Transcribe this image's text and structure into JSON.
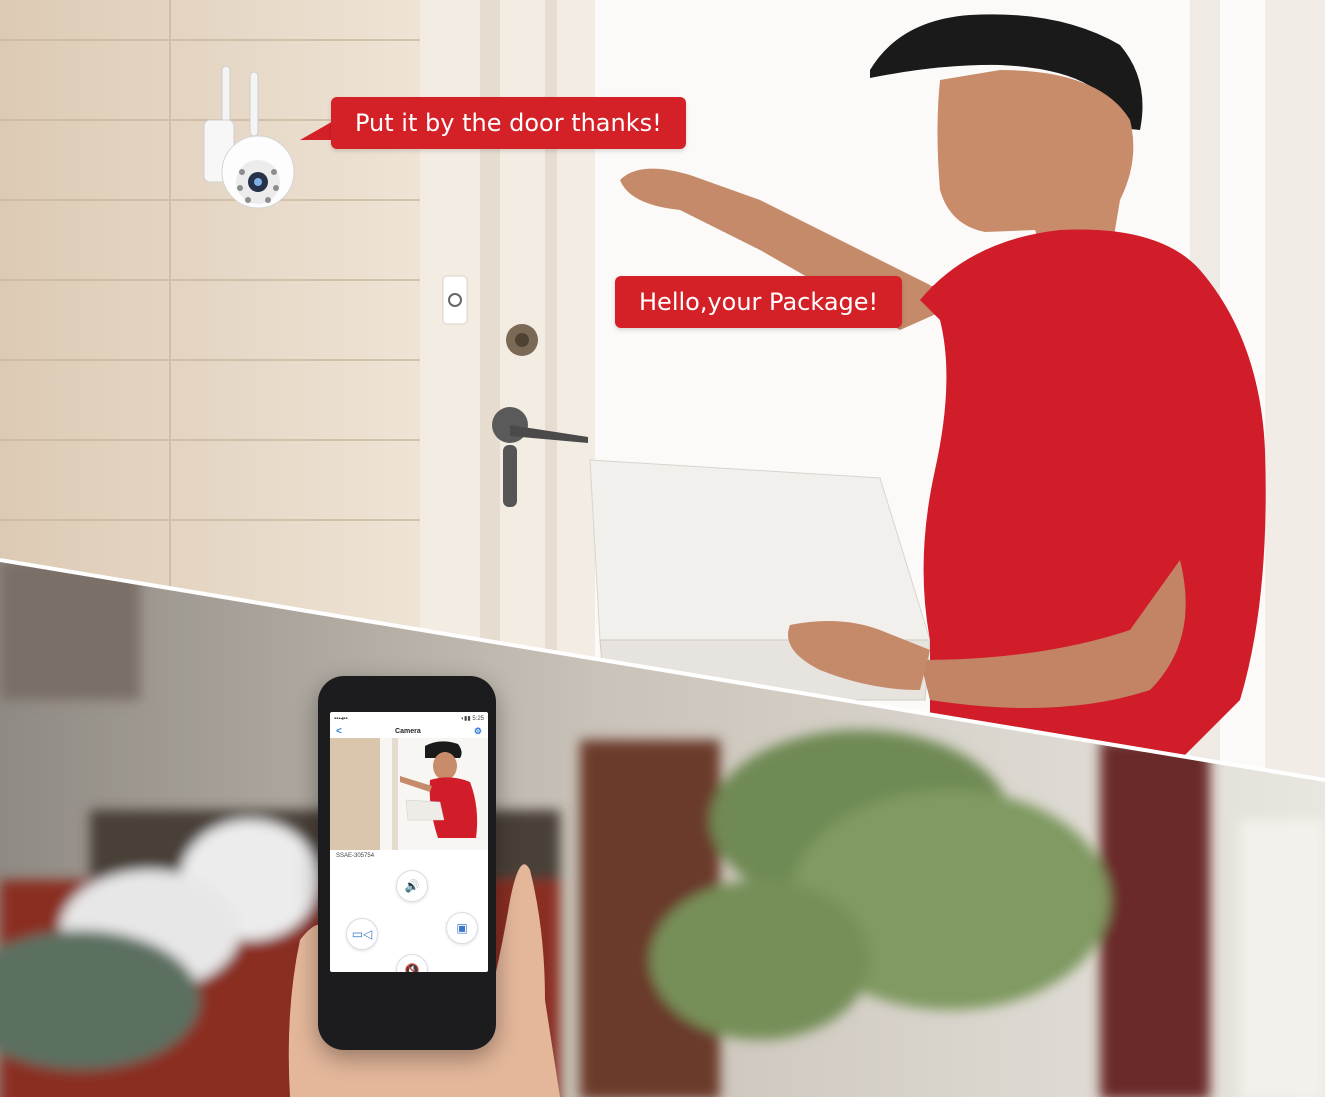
{
  "image_title": "",
  "bubbles": {
    "camera_speech": "Put it by the door thanks!",
    "courier_speech": "Hello,your Package!"
  },
  "phone": {
    "status_time": "5:25",
    "status_left": "▪▪▪◂▪▪",
    "status_right": "◖▮▮",
    "nav_back": "<",
    "nav_title": "Camera",
    "nav_settings": "⚙",
    "device_id": "SSAE-305754",
    "controls": {
      "speaker": "🔊",
      "record": "▭◁",
      "snapshot": "▣",
      "mute": "🔇"
    }
  },
  "colors": {
    "bubble_red": "#d42027",
    "shirt_red": "#d11c2a",
    "app_blue": "#2e7bd6"
  }
}
